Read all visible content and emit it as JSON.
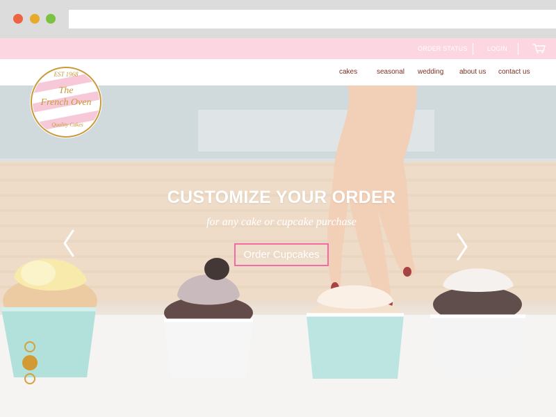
{
  "browser": {
    "window_controls": [
      "close",
      "minimize",
      "maximize"
    ],
    "url": ""
  },
  "topbar": {
    "order_status": "ORDER STATUS",
    "login": "LOGIN",
    "cart_icon": "cart-icon"
  },
  "logo": {
    "est": "EST 1968",
    "name_line1": "The",
    "name_line2": "French Oven",
    "tagline": "Quality Cakes"
  },
  "nav": {
    "items": [
      "cakes",
      "seasonal",
      "wedding",
      "about us",
      "contact us"
    ]
  },
  "hero": {
    "title": "CUSTOMIZE YOUR ORDER",
    "subtitle": "for any cake or cupcake purchase",
    "cta_label": "Order Cupcakes",
    "prev_icon": "chevron-left-icon",
    "next_icon": "chevron-right-icon",
    "slide_indicators": 3,
    "active_slide": 2
  },
  "colors": {
    "topbar_bg": "#fcd6e0",
    "nav_text": "#7a2e20",
    "cta_border": "#f36aa6",
    "indicator": "#d19a32",
    "logo_gold": "#c89a3a"
  }
}
